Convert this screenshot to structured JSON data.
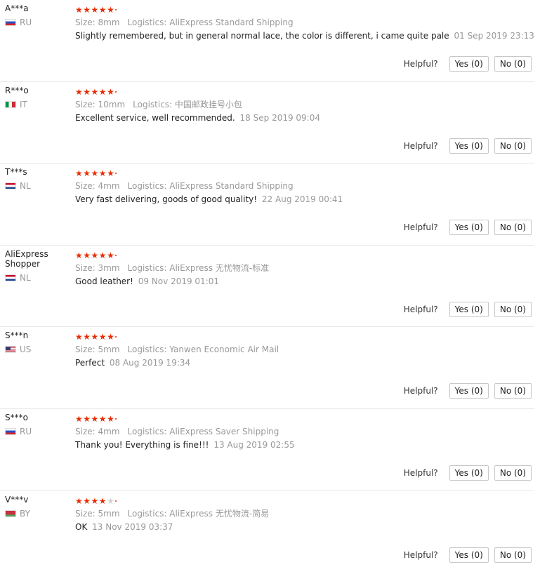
{
  "helpful_label": "Helpful?",
  "reviews": [
    {
      "user": "A***a",
      "country": "RU",
      "flag": "ru",
      "rating": 5,
      "size": "Size: 8mm",
      "logistics": "Logistics: AliExpress Standard Shipping",
      "text": "Slightly remembered, but in general normal lace, the color is different, i came quite pale",
      "date": "01 Sep 2019 23:13",
      "yes": "Yes (0)",
      "no": "No (0)"
    },
    {
      "user": "R***o",
      "country": "IT",
      "flag": "it",
      "rating": 5,
      "size": "Size: 10mm",
      "logistics": "Logistics: 中国邮政挂号小包",
      "text": "Excellent service, well recommended.",
      "date": "18 Sep 2019 09:04",
      "yes": "Yes (0)",
      "no": "No (0)"
    },
    {
      "user": "T***s",
      "country": "NL",
      "flag": "nl",
      "rating": 5,
      "size": "Size: 4mm",
      "logistics": "Logistics: AliExpress Standard Shipping",
      "text": "Very fast delivering, goods of good quality!",
      "date": "22 Aug 2019 00:41",
      "yes": "Yes (0)",
      "no": "No (0)"
    },
    {
      "user": "AliExpress Shopper",
      "country": "NL",
      "flag": "nl",
      "rating": 5,
      "size": "Size: 3mm",
      "logistics": "Logistics: AliExpress 无忧物流-标准",
      "text": "Good leather!",
      "date": "09 Nov 2019 01:01",
      "yes": "Yes (0)",
      "no": "No (0)"
    },
    {
      "user": "S***n",
      "country": "US",
      "flag": "us",
      "rating": 5,
      "size": "Size: 5mm",
      "logistics": "Logistics: Yanwen Economic Air Mail",
      "text": "Perfect",
      "date": "08 Aug 2019 19:34",
      "yes": "Yes (0)",
      "no": "No (0)"
    },
    {
      "user": "S***o",
      "country": "RU",
      "flag": "ru",
      "rating": 5,
      "size": "Size: 4mm",
      "logistics": "Logistics: AliExpress Saver Shipping",
      "text": "Thank you! Everything is fine!!!",
      "date": "13 Aug 2019 02:55",
      "yes": "Yes (0)",
      "no": "No (0)"
    },
    {
      "user": "V***v",
      "country": "BY",
      "flag": "by",
      "rating": 4,
      "size": "Size: 5mm",
      "logistics": "Logistics: AliExpress 无忧物流-简易",
      "text": "OK",
      "date": "13 Nov 2019 03:37",
      "yes": "Yes (0)",
      "no": "No (0)"
    }
  ]
}
